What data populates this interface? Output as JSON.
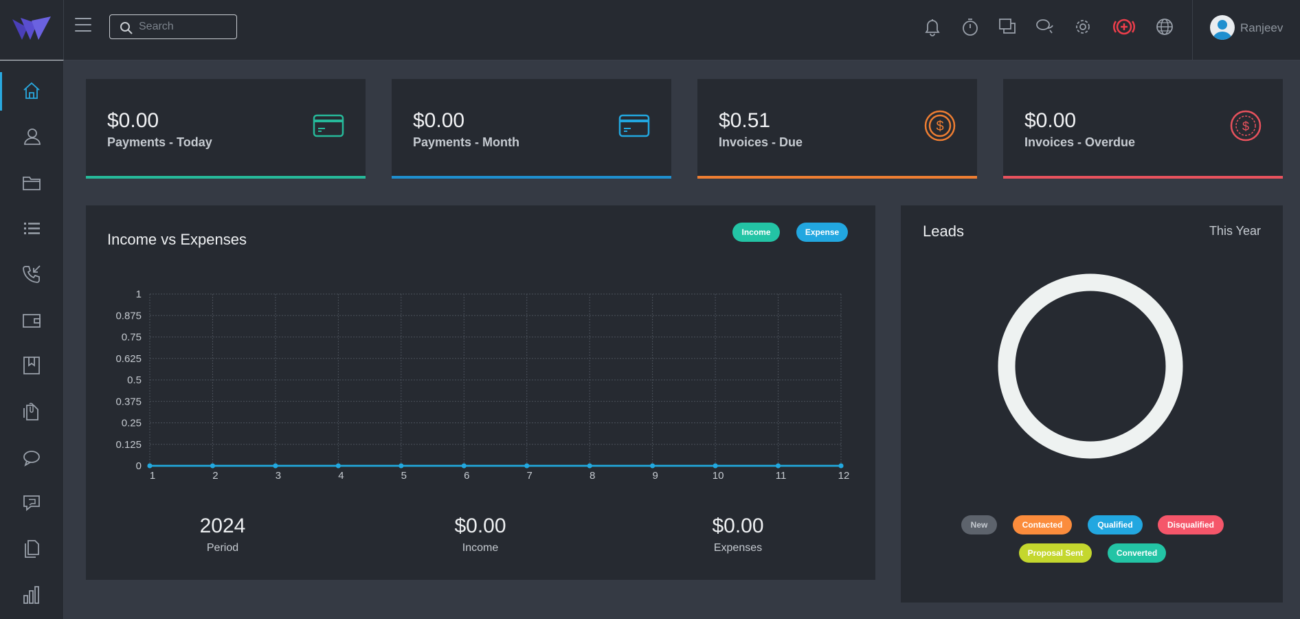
{
  "header": {
    "search_placeholder": "Search",
    "user_name": "Ranjeev",
    "icons": [
      "bell-icon",
      "timer-icon",
      "windows-icon",
      "chat-icon",
      "gear-icon",
      "plus-circle-icon",
      "globe-icon"
    ]
  },
  "sidebar": {
    "items": [
      "home-icon",
      "users-icon",
      "folder-icon",
      "list-icon",
      "phone-icon",
      "wallet-icon",
      "bookmark-icon",
      "files-icon",
      "chat-icon",
      "support-icon",
      "documents-icon",
      "reports-icon"
    ]
  },
  "cards": [
    {
      "amount": "$0.00",
      "label": "Payments - Today",
      "color": "#26b99a"
    },
    {
      "amount": "$0.00",
      "label": "Payments - Month",
      "color": "#1f8fcf"
    },
    {
      "amount": "$0.51",
      "label": "Invoices - Due",
      "color": "#ef7e32"
    },
    {
      "amount": "$0.00",
      "label": "Invoices - Overdue",
      "color": "#e9525d"
    }
  ],
  "income_expenses": {
    "title": "Income vs Expenses",
    "legend_income": "Income",
    "legend_expense": "Expense",
    "period_value": "2024",
    "period_label": "Period",
    "income_value": "$0.00",
    "income_label": "Income",
    "expenses_value": "$0.00",
    "expenses_label": "Expenses"
  },
  "leads": {
    "title": "Leads",
    "range": "This Year",
    "statuses": [
      "New",
      "Contacted",
      "Qualified",
      "Disqualified",
      "Proposal Sent",
      "Converted"
    ],
    "status_colors": [
      "#5d636c",
      "#fb8c3c",
      "#22a7e0",
      "#f5566a",
      "#c4d72e",
      "#23c4a5"
    ]
  },
  "chart_data": {
    "type": "line",
    "title": "Income vs Expenses",
    "x": [
      1,
      2,
      3,
      4,
      5,
      6,
      7,
      8,
      9,
      10,
      11,
      12
    ],
    "ylim": [
      0,
      1
    ],
    "yticks": [
      "0",
      "0.125",
      "0.25",
      "0.375",
      "0.5",
      "0.625",
      "0.75",
      "0.875",
      "1"
    ],
    "series": [
      {
        "name": "Income",
        "color": "#23c4a5",
        "values": [
          0,
          0,
          0,
          0,
          0,
          0,
          0,
          0,
          0,
          0,
          0,
          0
        ]
      },
      {
        "name": "Expense",
        "color": "#22a7e0",
        "values": [
          0,
          0,
          0,
          0,
          0,
          0,
          0,
          0,
          0,
          0,
          0,
          0
        ]
      }
    ],
    "grid": true
  }
}
